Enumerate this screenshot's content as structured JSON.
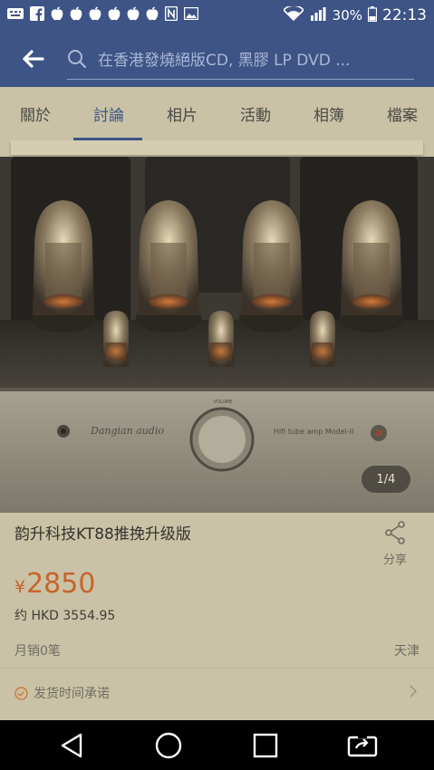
{
  "status_bar": {
    "icons": [
      "notification-icon",
      "facebook-icon",
      "apple-icon",
      "apple-icon",
      "apple-icon",
      "apple-icon",
      "apple-icon",
      "apple-icon",
      "nfc-icon",
      "image-icon",
      "wifi-icon",
      "signal-4g-icon"
    ],
    "battery": "30%",
    "time": "22:13"
  },
  "top_bar": {
    "search_placeholder": "在香港發燒絕版CD, 黑膠 LP DVD ..."
  },
  "tabs": [
    {
      "label": "關於"
    },
    {
      "label": "討論"
    },
    {
      "label": "相片"
    },
    {
      "label": "活動"
    },
    {
      "label": "相簿"
    },
    {
      "label": "檔案"
    }
  ],
  "active_tab": "討論",
  "product": {
    "image_label": "Hifi tube amp Model-II",
    "brand_script": "Dangian audio",
    "page_indicator": "1/4",
    "title": "韵升科技KT88推挽升级版",
    "share_label": "分享",
    "currency": "¥",
    "price": "2850",
    "approx_price": "约 HKD 3554.95",
    "sales": "月销0笔",
    "location": "天津",
    "shipping_promise": "发货时间承诺"
  },
  "nav_bar": {
    "buttons": [
      "back-triangle-icon",
      "home-circle-icon",
      "recents-square-icon",
      "screen-share-icon"
    ]
  },
  "colors": {
    "brand": "#3e5486",
    "price": "#c8642a",
    "background_overlay": "#c9c2a6"
  }
}
